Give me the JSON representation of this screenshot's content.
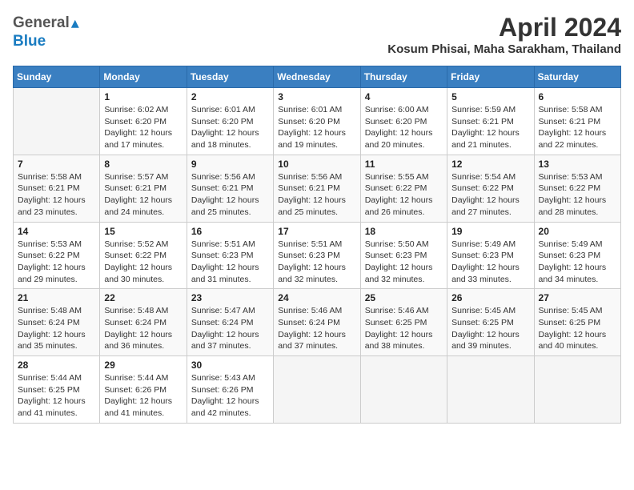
{
  "header": {
    "logo_general": "General",
    "logo_blue": "Blue",
    "month": "April 2024",
    "location": "Kosum Phisai, Maha Sarakham, Thailand"
  },
  "weekdays": [
    "Sunday",
    "Monday",
    "Tuesday",
    "Wednesday",
    "Thursday",
    "Friday",
    "Saturday"
  ],
  "weeks": [
    [
      {
        "day": "",
        "info": ""
      },
      {
        "day": "1",
        "info": "Sunrise: 6:02 AM\nSunset: 6:20 PM\nDaylight: 12 hours\nand 17 minutes."
      },
      {
        "day": "2",
        "info": "Sunrise: 6:01 AM\nSunset: 6:20 PM\nDaylight: 12 hours\nand 18 minutes."
      },
      {
        "day": "3",
        "info": "Sunrise: 6:01 AM\nSunset: 6:20 PM\nDaylight: 12 hours\nand 19 minutes."
      },
      {
        "day": "4",
        "info": "Sunrise: 6:00 AM\nSunset: 6:20 PM\nDaylight: 12 hours\nand 20 minutes."
      },
      {
        "day": "5",
        "info": "Sunrise: 5:59 AM\nSunset: 6:21 PM\nDaylight: 12 hours\nand 21 minutes."
      },
      {
        "day": "6",
        "info": "Sunrise: 5:58 AM\nSunset: 6:21 PM\nDaylight: 12 hours\nand 22 minutes."
      }
    ],
    [
      {
        "day": "7",
        "info": "Sunrise: 5:58 AM\nSunset: 6:21 PM\nDaylight: 12 hours\nand 23 minutes."
      },
      {
        "day": "8",
        "info": "Sunrise: 5:57 AM\nSunset: 6:21 PM\nDaylight: 12 hours\nand 24 minutes."
      },
      {
        "day": "9",
        "info": "Sunrise: 5:56 AM\nSunset: 6:21 PM\nDaylight: 12 hours\nand 25 minutes."
      },
      {
        "day": "10",
        "info": "Sunrise: 5:56 AM\nSunset: 6:21 PM\nDaylight: 12 hours\nand 25 minutes."
      },
      {
        "day": "11",
        "info": "Sunrise: 5:55 AM\nSunset: 6:22 PM\nDaylight: 12 hours\nand 26 minutes."
      },
      {
        "day": "12",
        "info": "Sunrise: 5:54 AM\nSunset: 6:22 PM\nDaylight: 12 hours\nand 27 minutes."
      },
      {
        "day": "13",
        "info": "Sunrise: 5:53 AM\nSunset: 6:22 PM\nDaylight: 12 hours\nand 28 minutes."
      }
    ],
    [
      {
        "day": "14",
        "info": "Sunrise: 5:53 AM\nSunset: 6:22 PM\nDaylight: 12 hours\nand 29 minutes."
      },
      {
        "day": "15",
        "info": "Sunrise: 5:52 AM\nSunset: 6:22 PM\nDaylight: 12 hours\nand 30 minutes."
      },
      {
        "day": "16",
        "info": "Sunrise: 5:51 AM\nSunset: 6:23 PM\nDaylight: 12 hours\nand 31 minutes."
      },
      {
        "day": "17",
        "info": "Sunrise: 5:51 AM\nSunset: 6:23 PM\nDaylight: 12 hours\nand 32 minutes."
      },
      {
        "day": "18",
        "info": "Sunrise: 5:50 AM\nSunset: 6:23 PM\nDaylight: 12 hours\nand 32 minutes."
      },
      {
        "day": "19",
        "info": "Sunrise: 5:49 AM\nSunset: 6:23 PM\nDaylight: 12 hours\nand 33 minutes."
      },
      {
        "day": "20",
        "info": "Sunrise: 5:49 AM\nSunset: 6:23 PM\nDaylight: 12 hours\nand 34 minutes."
      }
    ],
    [
      {
        "day": "21",
        "info": "Sunrise: 5:48 AM\nSunset: 6:24 PM\nDaylight: 12 hours\nand 35 minutes."
      },
      {
        "day": "22",
        "info": "Sunrise: 5:48 AM\nSunset: 6:24 PM\nDaylight: 12 hours\nand 36 minutes."
      },
      {
        "day": "23",
        "info": "Sunrise: 5:47 AM\nSunset: 6:24 PM\nDaylight: 12 hours\nand 37 minutes."
      },
      {
        "day": "24",
        "info": "Sunrise: 5:46 AM\nSunset: 6:24 PM\nDaylight: 12 hours\nand 37 minutes."
      },
      {
        "day": "25",
        "info": "Sunrise: 5:46 AM\nSunset: 6:25 PM\nDaylight: 12 hours\nand 38 minutes."
      },
      {
        "day": "26",
        "info": "Sunrise: 5:45 AM\nSunset: 6:25 PM\nDaylight: 12 hours\nand 39 minutes."
      },
      {
        "day": "27",
        "info": "Sunrise: 5:45 AM\nSunset: 6:25 PM\nDaylight: 12 hours\nand 40 minutes."
      }
    ],
    [
      {
        "day": "28",
        "info": "Sunrise: 5:44 AM\nSunset: 6:25 PM\nDaylight: 12 hours\nand 41 minutes."
      },
      {
        "day": "29",
        "info": "Sunrise: 5:44 AM\nSunset: 6:26 PM\nDaylight: 12 hours\nand 41 minutes."
      },
      {
        "day": "30",
        "info": "Sunrise: 5:43 AM\nSunset: 6:26 PM\nDaylight: 12 hours\nand 42 minutes."
      },
      {
        "day": "",
        "info": ""
      },
      {
        "day": "",
        "info": ""
      },
      {
        "day": "",
        "info": ""
      },
      {
        "day": "",
        "info": ""
      }
    ]
  ]
}
